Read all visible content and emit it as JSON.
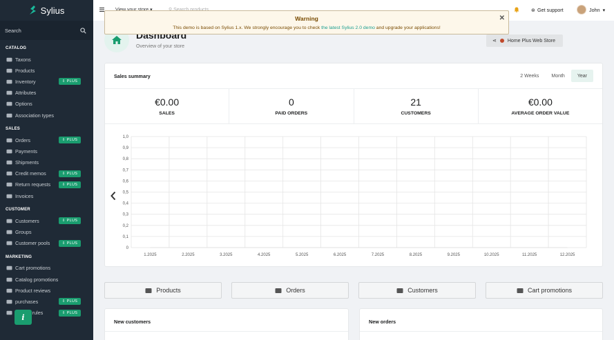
{
  "sidebar": {
    "logo_text": "Sylius",
    "search_label": "Search",
    "sections": [
      {
        "title": "CATALOG",
        "items": [
          {
            "label": "Taxons",
            "icon": "folder-icon",
            "plus": false
          },
          {
            "label": "Products",
            "icon": "cube-icon",
            "plus": false
          },
          {
            "label": "Inventory",
            "icon": "history-icon",
            "plus": true
          },
          {
            "label": "Attributes",
            "icon": "cubes-icon",
            "plus": false
          },
          {
            "label": "Options",
            "icon": "options-icon",
            "plus": false
          },
          {
            "label": "Association types",
            "icon": "tasks-icon",
            "plus": false
          }
        ]
      },
      {
        "title": "SALES",
        "items": [
          {
            "label": "Orders",
            "icon": "cart-icon",
            "plus": true
          },
          {
            "label": "Payments",
            "icon": "payment-icon",
            "plus": false
          },
          {
            "label": "Shipments",
            "icon": "truck-icon",
            "plus": false
          },
          {
            "label": "Credit memos",
            "icon": "inbox-icon",
            "plus": true
          },
          {
            "label": "Return requests",
            "icon": "exchange-icon",
            "plus": true
          },
          {
            "label": "Invoices",
            "icon": "file-icon",
            "plus": false
          }
        ]
      },
      {
        "title": "CUSTOMER",
        "items": [
          {
            "label": "Customers",
            "icon": "users-icon",
            "plus": true
          },
          {
            "label": "Groups",
            "icon": "archive-icon",
            "plus": false
          },
          {
            "label": "Customer pools",
            "icon": "lock-icon",
            "plus": true
          }
        ]
      },
      {
        "title": "MARKETING",
        "items": [
          {
            "label": "Cart promotions",
            "icon": "tag-icon",
            "plus": false
          },
          {
            "label": "Catalog promotions",
            "icon": "percent-icon",
            "plus": false
          },
          {
            "label": "Product reviews",
            "icon": "newspaper-icon",
            "plus": false
          },
          {
            "label": "purchases",
            "icon": "gift-icon",
            "plus": true
          },
          {
            "label": "Loyalty rules",
            "icon": "heart-icon",
            "plus": true
          }
        ]
      }
    ],
    "plus_label": "PLUS",
    "info_glyph": "i"
  },
  "topbar": {
    "view_store": "View your store",
    "search_placeholder": "Search products",
    "support": "Get support",
    "user": "John"
  },
  "warning": {
    "title": "Warning",
    "message_before": "This demo is based on Sylius 1.x. We strongly encourage you to check ",
    "link_text": "the latest Sylius 2.0 demo",
    "message_after": " and upgrade your applications!"
  },
  "header": {
    "title": "Dashboard",
    "subtitle": "Overview of your store",
    "channel": "Home Plus Web Store"
  },
  "sales_summary": {
    "title": "Sales summary",
    "periods": [
      "2 Weeks",
      "Month",
      "Year"
    ],
    "active_period": "Year",
    "stats": [
      {
        "value": "€0.00",
        "label": "SALES"
      },
      {
        "value": "0",
        "label": "PAID ORDERS"
      },
      {
        "value": "21",
        "label": "CUSTOMERS"
      },
      {
        "value": "€0.00",
        "label": "AVERAGE ORDER VALUE"
      }
    ]
  },
  "chart_data": {
    "type": "line",
    "categories": [
      "1.2025",
      "2.2025",
      "3.2025",
      "4.2025",
      "5.2025",
      "6.2025",
      "7.2025",
      "8.2025",
      "9.2025",
      "10.2025",
      "11.2025",
      "12.2025"
    ],
    "series": [
      {
        "values": [
          0,
          0,
          0,
          0,
          0,
          0,
          0,
          0,
          0,
          0,
          0,
          0
        ]
      }
    ],
    "yticks": [
      "0",
      "0,1",
      "0,2",
      "0,3",
      "0,4",
      "0,5",
      "0,6",
      "0,7",
      "0,8",
      "0,9",
      "1,0"
    ],
    "ylim": [
      0,
      1
    ],
    "grid": true
  },
  "quick_links": [
    {
      "label": "Products",
      "icon": "cubes-icon"
    },
    {
      "label": "Orders",
      "icon": "cart-icon"
    },
    {
      "label": "Customers",
      "icon": "users-icon"
    },
    {
      "label": "Cart promotions",
      "icon": "payment-icon"
    }
  ],
  "bottom_cards": {
    "new_customers": "New customers",
    "new_orders": "New orders"
  }
}
